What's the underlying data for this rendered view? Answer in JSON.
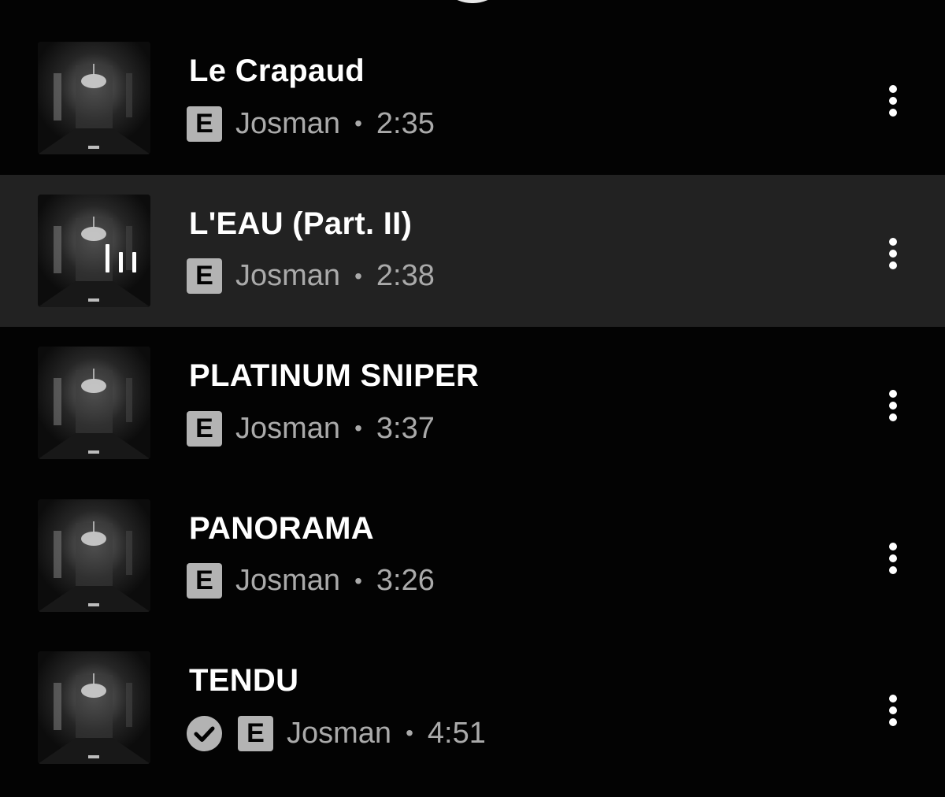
{
  "tracks": [
    {
      "title": "Le Crapaud",
      "badge": "E",
      "artist": "Josman",
      "separator": "•",
      "duration": "2:35",
      "playing": false,
      "downloaded": false
    },
    {
      "title": "L'EAU (Part. II)",
      "badge": "E",
      "artist": "Josman",
      "separator": "•",
      "duration": "2:38",
      "playing": true,
      "downloaded": false
    },
    {
      "title": "PLATINUM SNIPER",
      "badge": "E",
      "artist": "Josman",
      "separator": "•",
      "duration": "3:37",
      "playing": false,
      "downloaded": false
    },
    {
      "title": "PANORAMA",
      "badge": "E",
      "artist": "Josman",
      "separator": "•",
      "duration": "3:26",
      "playing": false,
      "downloaded": false
    },
    {
      "title": "TENDU",
      "badge": "E",
      "artist": "Josman",
      "separator": "•",
      "duration": "4:51",
      "playing": false,
      "downloaded": true
    }
  ],
  "icons": {
    "menu": "more-vertical-icon",
    "playing": "equalizer-icon",
    "downloaded": "check-circle-icon",
    "explicit": "explicit-badge"
  },
  "colors": {
    "background": "#030303",
    "playing_row": "#222222",
    "title": "#ffffff",
    "subtitle": "#aaaaaa",
    "badge": "#b3b3b3"
  }
}
